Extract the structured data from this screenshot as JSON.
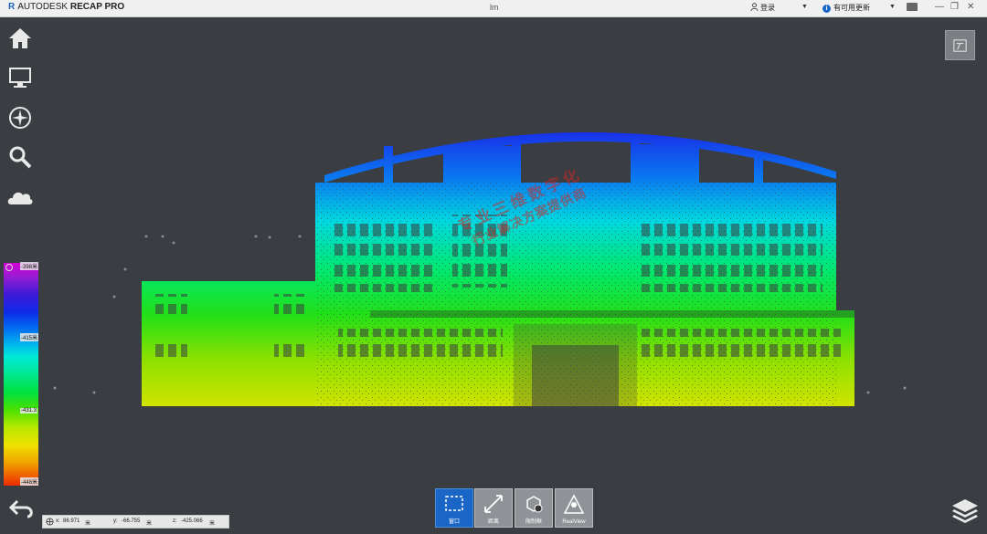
{
  "app": {
    "logo_mark": "R",
    "vendor": "AUTODESK",
    "product": "RECAP PRO",
    "window_title": "lm",
    "sign_in": "登录",
    "updates": "有可用更新",
    "minimize_icon": "minimize-icon",
    "restore_icon": "restore-icon",
    "close_icon": "close-icon"
  },
  "left_toolbar": [
    {
      "icon": "home-icon"
    },
    {
      "icon": "display-icon"
    },
    {
      "icon": "navigation-compass-icon"
    },
    {
      "icon": "search-icon"
    },
    {
      "icon": "cloud-icon"
    }
  ],
  "legend": {
    "ticks": [
      "-398米",
      "-415米",
      "-431.3",
      "-448米"
    ],
    "colors": [
      "#d400d4",
      "#3f1ad8",
      "#0072f0",
      "#00e8d8",
      "#00e040",
      "#b8e800",
      "#f0e000",
      "#ee2a00"
    ]
  },
  "coords": {
    "x_label": "x:",
    "x_value": "86.971",
    "x_unit": "米",
    "y_label": "y:",
    "y_value": "-66.755",
    "y_unit": "米",
    "z_label": "z:",
    "z_value": "-425.066",
    "z_unit": "米"
  },
  "bottom_tools": [
    {
      "label": "窗口",
      "icon": "window-select-icon",
      "active": true
    },
    {
      "label": "距离",
      "icon": "distance-icon",
      "active": false
    },
    {
      "label": "限制框",
      "icon": "limit-box-icon",
      "active": false
    },
    {
      "label": "RealView",
      "icon": "realview-icon",
      "active": false
    }
  ],
  "watermark": {
    "line1": "专业三维数字化",
    "line2": "行业解决方案提供商"
  },
  "top_right_button": {
    "icon": "view-cube-icon"
  },
  "layers_button": {
    "icon": "layers-icon"
  },
  "back_button": {
    "icon": "back-arrow-icon"
  }
}
